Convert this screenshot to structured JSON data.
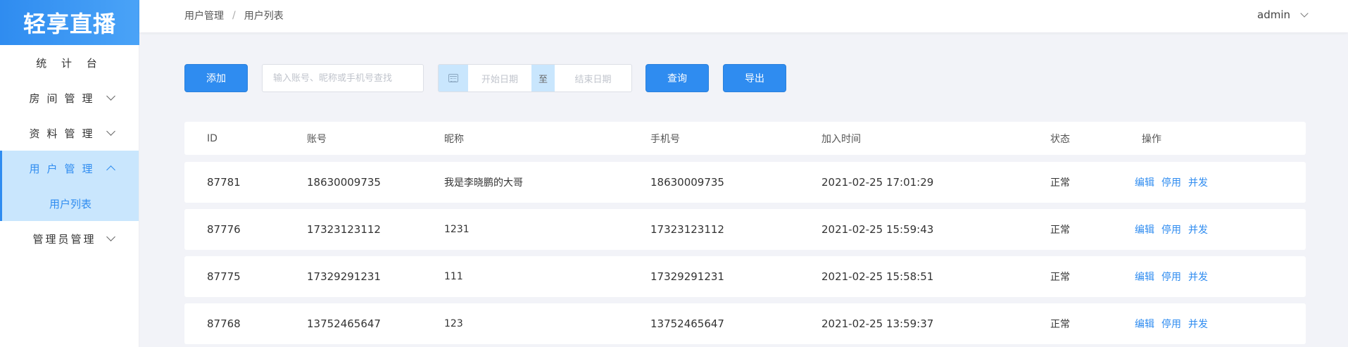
{
  "app": {
    "logo_text": "轻享直播"
  },
  "sidebar": {
    "items": [
      {
        "label": "统 计 台"
      },
      {
        "label": "房间管理"
      },
      {
        "label": "资料管理"
      },
      {
        "label": "用户管理"
      },
      {
        "label": "管理员管理"
      }
    ],
    "sub_item": "用户列表"
  },
  "header": {
    "breadcrumb": [
      "用户管理",
      "用户列表"
    ],
    "separator": "/",
    "username": "admin"
  },
  "toolbar": {
    "add_label": "添加",
    "search_placeholder": "输入账号、昵称或手机号查找",
    "date_start_placeholder": "开始日期",
    "date_to": "至",
    "date_end_placeholder": "结束日期",
    "query_label": "查询",
    "export_label": "导出"
  },
  "table": {
    "columns": [
      "ID",
      "账号",
      "昵称",
      "手机号",
      "加入时间",
      "状态",
      "操作"
    ],
    "rows": [
      {
        "id": "87781",
        "account": "18630009735",
        "nickname": "我是李晓鹏的大哥",
        "phone": "18630009735",
        "joined": "2021-02-25 17:01:29",
        "status": "正常"
      },
      {
        "id": "87776",
        "account": "17323123112",
        "nickname": "1231",
        "phone": "17323123112",
        "joined": "2021-02-25 15:59:43",
        "status": "正常"
      },
      {
        "id": "87775",
        "account": "17329291231",
        "nickname": "111",
        "phone": "17329291231",
        "joined": "2021-02-25 15:58:51",
        "status": "正常"
      },
      {
        "id": "87768",
        "account": "13752465647",
        "nickname": "123",
        "phone": "13752465647",
        "joined": "2021-02-25 13:59:37",
        "status": "正常"
      }
    ],
    "actions": [
      "编辑",
      "停用",
      "并发"
    ]
  },
  "colors": {
    "accent": "#2f8cf0",
    "active_bg": "#c9e6fd",
    "page_bg": "#f2f3f8"
  }
}
